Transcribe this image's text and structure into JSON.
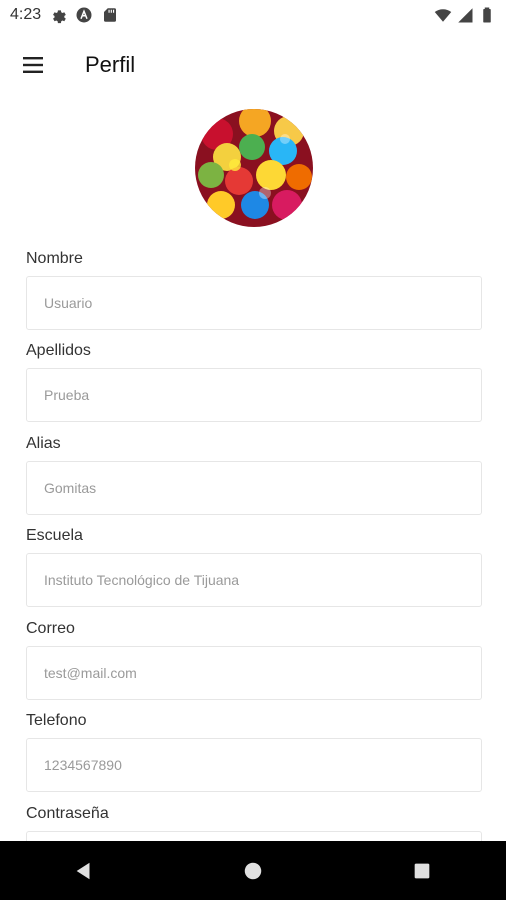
{
  "status_bar": {
    "time": "4:23",
    "left_icons": [
      "settings-icon",
      "a-badge-icon",
      "sd-card-icon"
    ],
    "right_icons": [
      "wifi-icon",
      "signal-icon",
      "battery-icon"
    ]
  },
  "app_bar": {
    "title": "Perfil",
    "menu_icon": "hamburger-menu-icon"
  },
  "avatar": {
    "description_icon": "gummy-bears-avatar"
  },
  "form": {
    "fields": [
      {
        "label": "Nombre",
        "placeholder": "Usuario"
      },
      {
        "label": "Apellidos",
        "placeholder": "Prueba"
      },
      {
        "label": "Alias",
        "placeholder": "Gomitas"
      },
      {
        "label": "Escuela",
        "placeholder": "Instituto Tecnológico de Tijuana"
      },
      {
        "label": "Correo",
        "placeholder": "test@mail.com"
      },
      {
        "label": "Telefono",
        "placeholder": "1234567890"
      },
      {
        "label": "Contraseña",
        "placeholder": ""
      }
    ]
  },
  "nav_bar": {
    "buttons": [
      "back-icon",
      "home-icon",
      "recents-icon"
    ]
  },
  "colors": {
    "background": "#ffffff",
    "text": "#333333",
    "field_border": "#e6e6e6",
    "placeholder": "#9a9a9a",
    "nav_bar": "#000000"
  }
}
